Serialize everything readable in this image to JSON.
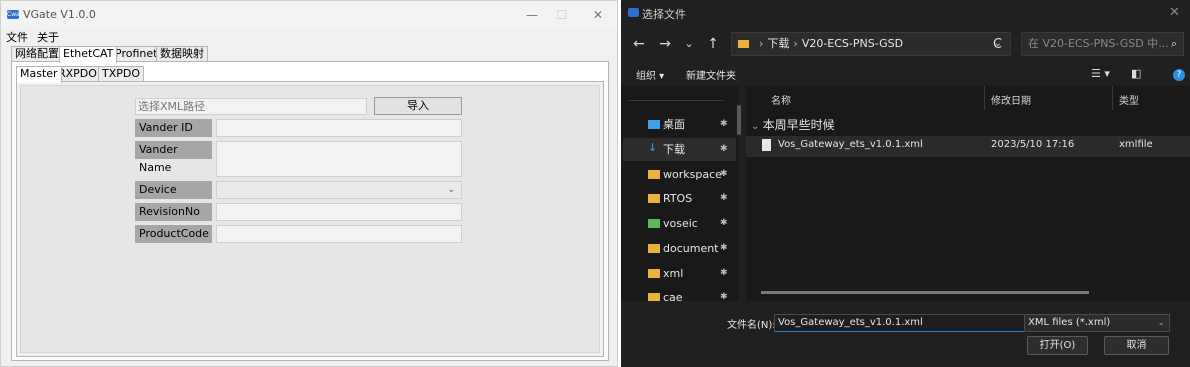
{
  "vgate": {
    "title": "VGate V1.0.0",
    "app_icon_text": "Cwa",
    "controls": {
      "minimize": "—",
      "maximize": "☐",
      "close": "✕"
    },
    "menu": [
      "文件",
      "关于"
    ],
    "outer_tabs": [
      "网络配置",
      "EthetCAT",
      "Profinet",
      "数据映射"
    ],
    "inner_tabs": [
      "Master",
      "RXPDO",
      "TXPDO"
    ],
    "xml_path_placeholder": "选择XML路径",
    "import_button": "导入",
    "fields": {
      "vander_id": "Vander ID",
      "vander_name": "Vander Name",
      "device_name": "Device Name",
      "revision_no": "RevisionNo",
      "product_code": "ProductCode"
    }
  },
  "dialog": {
    "title": "选择文件",
    "close": "✕",
    "nav": {
      "back": "←",
      "forward": "→",
      "recent": "⌄",
      "up": "↑",
      "refresh": "C"
    },
    "breadcrumb": [
      "下载",
      "V20-ECS-PNS-GSD"
    ],
    "search_placeholder": "在 V20-ECS-PNS-GSD 中...",
    "toolbar": {
      "organize": "组织 ▾",
      "new_folder": "新建文件夹",
      "help": "?"
    },
    "sidebar": [
      {
        "label": "桌面",
        "icon": "desktop-icon",
        "color": "#3aa0e8"
      },
      {
        "label": "下载",
        "icon": "download-icon",
        "color": "#3aa0e8",
        "selected": true
      },
      {
        "label": "workspace",
        "icon": "folder-icon",
        "color": "#e9b23a"
      },
      {
        "label": "RTOS",
        "icon": "folder-icon",
        "color": "#e9b23a"
      },
      {
        "label": "voseic",
        "icon": "folder-icon",
        "color": "#5bb75b"
      },
      {
        "label": "document",
        "icon": "folder-icon",
        "color": "#e9b23a"
      },
      {
        "label": "xml",
        "icon": "folder-icon",
        "color": "#e9b23a"
      },
      {
        "label": "cae",
        "icon": "folder-icon",
        "color": "#e9b23a"
      }
    ],
    "columns": {
      "name": "名称",
      "modified": "修改日期",
      "type": "类型"
    },
    "group": "本周早些时候",
    "files": [
      {
        "name": "Vos_Gateway_ets_v1.0.1.xml",
        "modified": "2023/5/10 17:16",
        "type": "xmlfile"
      }
    ],
    "filename_label": "文件名(N):",
    "filename_value": "Vos_Gateway_ets_v1.0.1.xml",
    "filetype": "XML files (*.xml)",
    "open_button": "打开(O)",
    "cancel_button": "取消"
  }
}
